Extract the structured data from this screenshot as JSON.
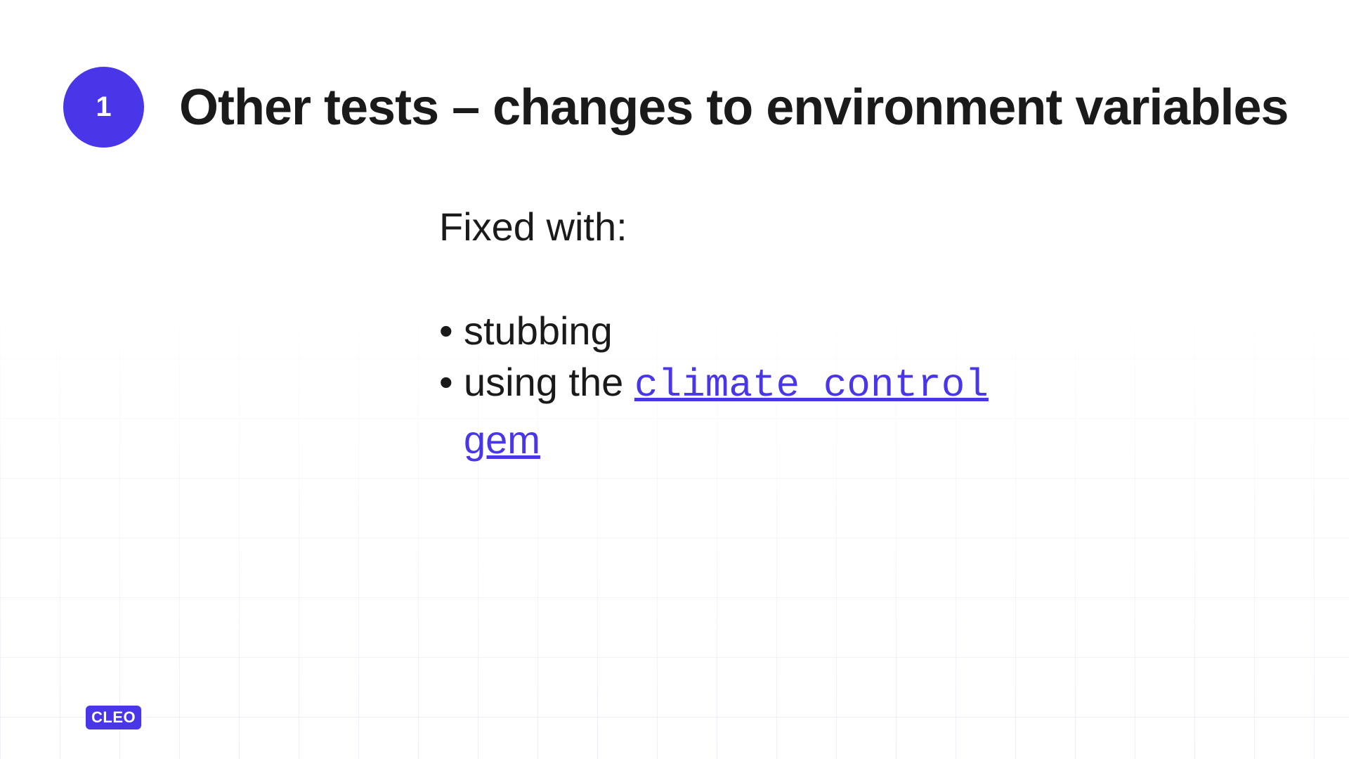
{
  "slide": {
    "number": "1",
    "title": "Other tests – changes to environment variables",
    "intro": "Fixed with:",
    "bullets": [
      {
        "text": "stubbing"
      },
      {
        "prefix": "using the ",
        "link_code": "climate_control",
        "link_text": "gem"
      }
    ]
  },
  "brand": {
    "logo": "CLEO"
  },
  "colors": {
    "accent": "#4936E8"
  }
}
